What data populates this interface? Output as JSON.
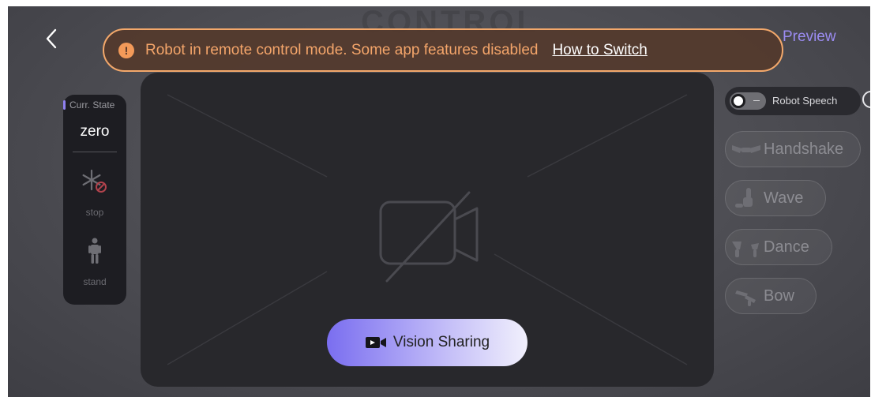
{
  "watermark": "CONTROL",
  "header": {
    "back_icon": "chevron-left-icon",
    "preview_label": "Preview"
  },
  "banner": {
    "icon": "info-icon",
    "message": "Robot in remote control mode. Some app features disabled",
    "link": "How to Switch",
    "border_color": "#f3a86b",
    "text_color": "#f4a56a"
  },
  "state_panel": {
    "label": "Curr. State",
    "value": "zero",
    "items": [
      {
        "label": "stop",
        "icon": "frozen-stop-icon"
      },
      {
        "label": "stand",
        "icon": "standing-figure-icon"
      }
    ]
  },
  "video": {
    "icon": "camera-off-icon",
    "button_label": "Vision Sharing",
    "button_icon": "video-camera-icon",
    "accent_color": "#7a6ef0"
  },
  "speech_toggle": {
    "label": "Robot Speech",
    "state": "off",
    "info_icon": "info-icon"
  },
  "actions": [
    {
      "label": "Handshake",
      "icon": "handshake-icon"
    },
    {
      "label": "Wave",
      "icon": "wave-icon"
    },
    {
      "label": "Dance",
      "icon": "dance-icon"
    },
    {
      "label": "Bow",
      "icon": "bow-icon"
    }
  ]
}
